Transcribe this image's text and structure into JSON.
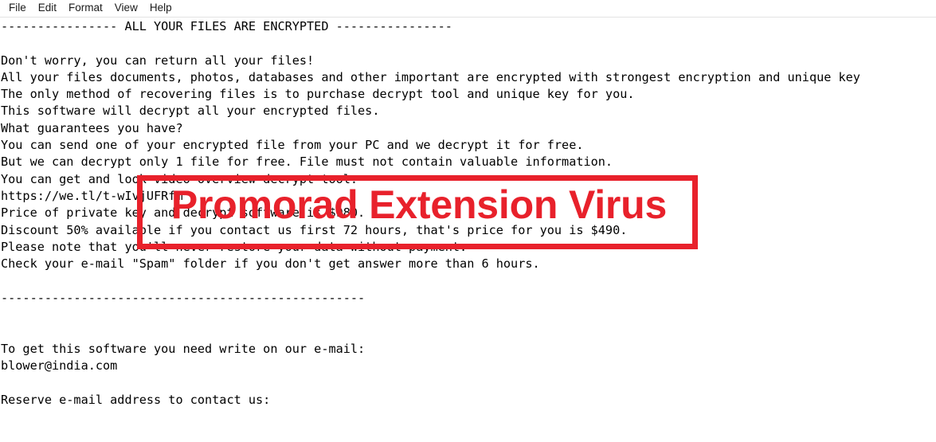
{
  "window": {
    "app": "Notepad",
    "background_color": "#ffffff"
  },
  "menubar": {
    "items": [
      {
        "label": "File",
        "name": "menu-file"
      },
      {
        "label": "Edit",
        "name": "menu-edit"
      },
      {
        "label": "Format",
        "name": "menu-format"
      },
      {
        "label": "View",
        "name": "menu-view"
      },
      {
        "label": "Help",
        "name": "menu-help"
      }
    ]
  },
  "document": {
    "lines": [
      "---------------- ALL YOUR FILES ARE ENCRYPTED ----------------",
      "",
      "Don't worry, you can return all your files!",
      "All your files documents, photos, databases and other important are encrypted with strongest encryption and unique key",
      "The only method of recovering files is to purchase decrypt tool and unique key for you.",
      "This software will decrypt all your encrypted files.",
      "What guarantees you have?",
      "You can send one of your encrypted file from your PC and we decrypt it for free.",
      "But we can decrypt only 1 file for free. File must not contain valuable information.",
      "You can get and look video overview decrypt tool:",
      "https://we.tl/t-wIvjUFRfm",
      "Price of private key and decrypt software is $980.",
      "Discount 50% available if you contact us first 72 hours, that's price for you is $490.",
      "Please note that you'll never restore your data without payment.",
      "Check your e-mail \"Spam\" folder if you don't get answer more than 6 hours.",
      "",
      "--------------------------------------------------",
      "",
      "",
      "To get this software you need write on our e-mail:",
      "blower@india.com",
      "",
      "Reserve e-mail address to contact us:"
    ],
    "text": "---------------- ALL YOUR FILES ARE ENCRYPTED ----------------\n\nDon't worry, you can return all your files!\nAll your files documents, photos, databases and other important are encrypted with strongest encryption and unique key\nThe only method of recovering files is to purchase decrypt tool and unique key for you.\nThis software will decrypt all your encrypted files.\nWhat guarantees you have?\nYou can send one of your encrypted file from your PC and we decrypt it for free.\nBut we can decrypt only 1 file for free. File must not contain valuable information.\nYou can get and look video overview decrypt tool:\nhttps://we.tl/t-wIvjUFRfm\nPrice of private key and decrypt software is $980.\nDiscount 50% available if you contact us first 72 hours, that's price for you is $490.\nPlease note that you'll never restore your data without payment.\nCheck your e-mail \"Spam\" folder if you don't get answer more than 6 hours.\n\n--------------------------------------------------\n\n\nTo get this software you need write on our e-mail:\nblower@india.com\n\nReserve e-mail address to contact us:",
    "ransom_price_full": "$980",
    "ransom_price_discounted": "$490",
    "discount_percent": "50%",
    "discount_window": "72 hours",
    "spam_check_hours": "6 hours",
    "contact_email": "blower@india.com",
    "video_url": "https://we.tl/t-wIvjUFRfm"
  },
  "annotation": {
    "label": "Promorad Extension Virus",
    "color": "#e8212b",
    "border_width_px": 7
  }
}
